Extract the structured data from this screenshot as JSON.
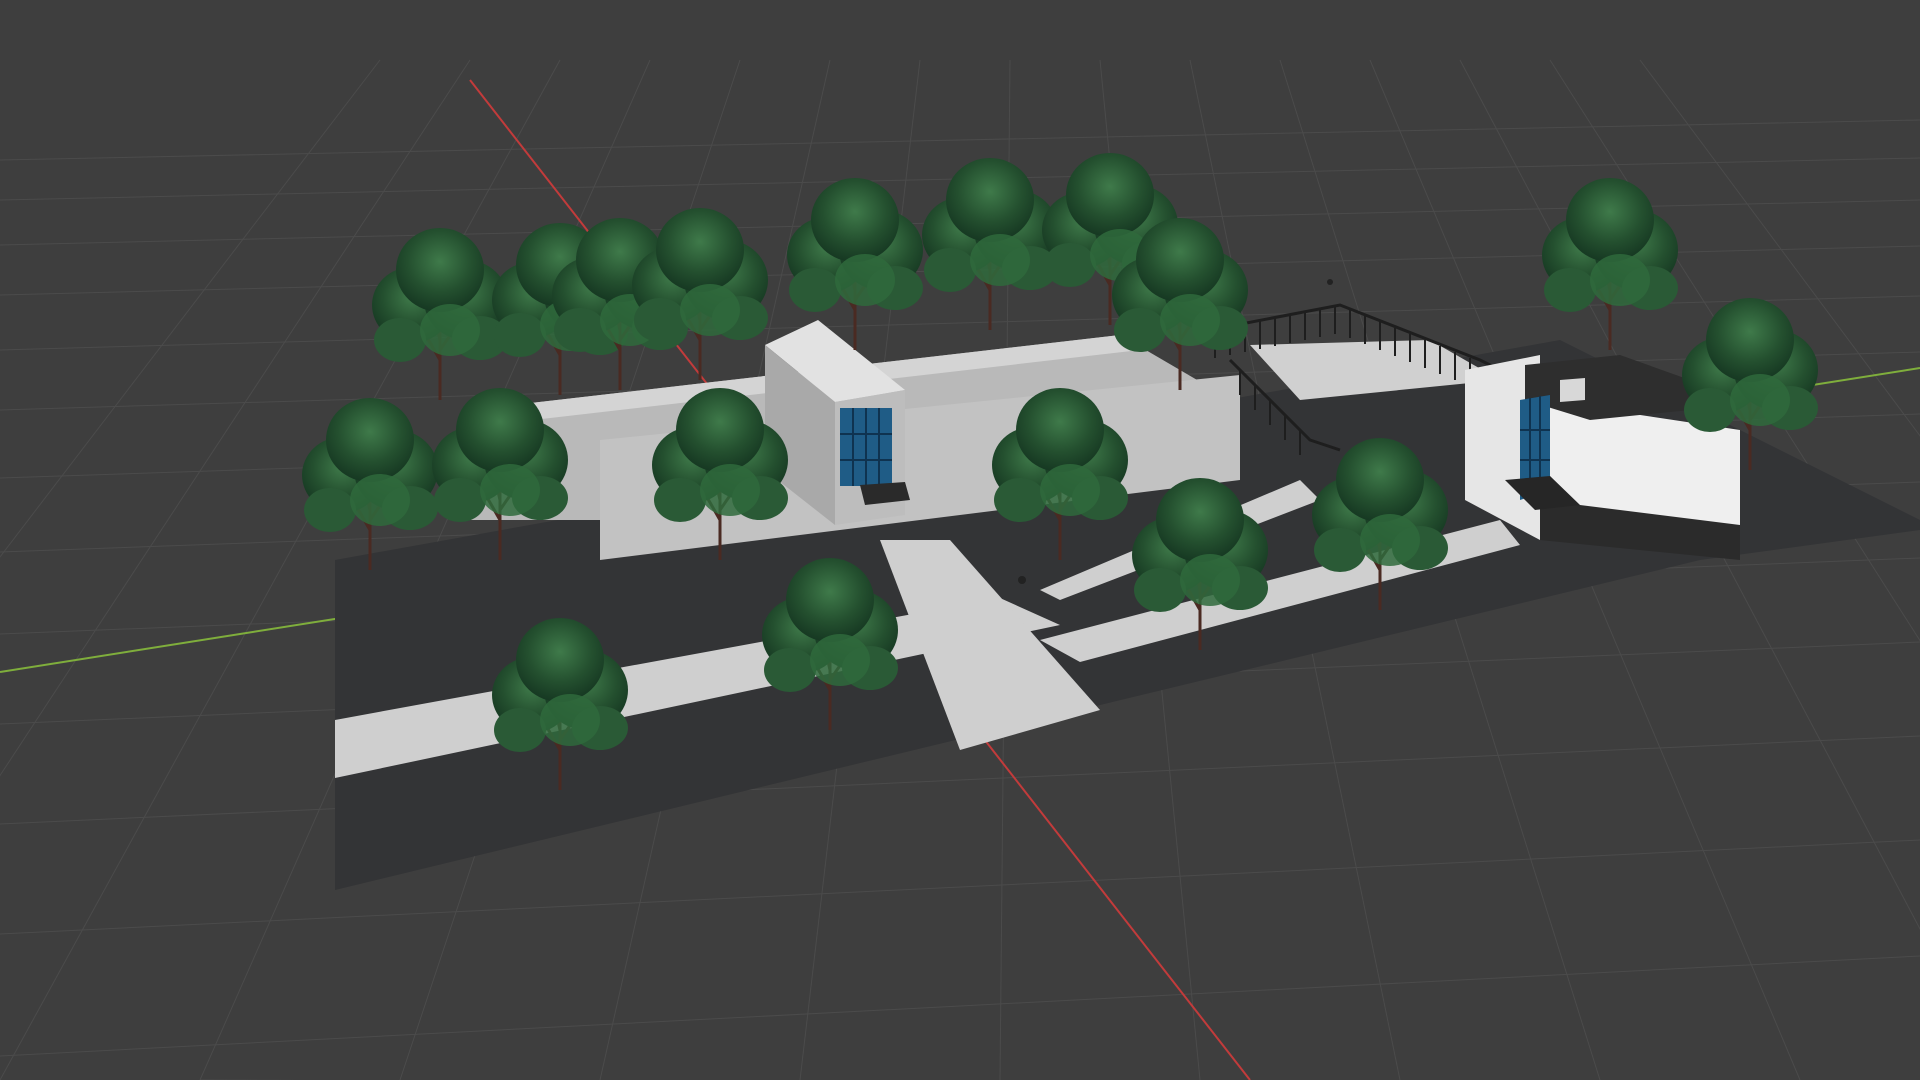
{
  "viewport": {
    "mode": "3d-viewport-solid-shading",
    "background_color": "#3f3f3f",
    "grid_line_color": "#4b4b4b",
    "x_axis_color": "#c23b3b",
    "y_axis_color": "#7fae3c"
  },
  "scene": {
    "objects": [
      {
        "name": "ground-plane",
        "color": "#333436"
      },
      {
        "name": "main-building",
        "color": "#c9c9c9"
      },
      {
        "name": "entrance-pavilion",
        "color": "#d6d6d6"
      },
      {
        "name": "entrance-glass-door",
        "color": "#1f5c86"
      },
      {
        "name": "walkways",
        "color": "#cfcfcf"
      },
      {
        "name": "side-pavilion",
        "color": "#e8e8e8"
      },
      {
        "name": "side-pavilion-glass",
        "color": "#1f5c86"
      },
      {
        "name": "fence",
        "color": "#1e1e1e"
      },
      {
        "name": "trees",
        "color": "#1f4a2a"
      }
    ]
  }
}
